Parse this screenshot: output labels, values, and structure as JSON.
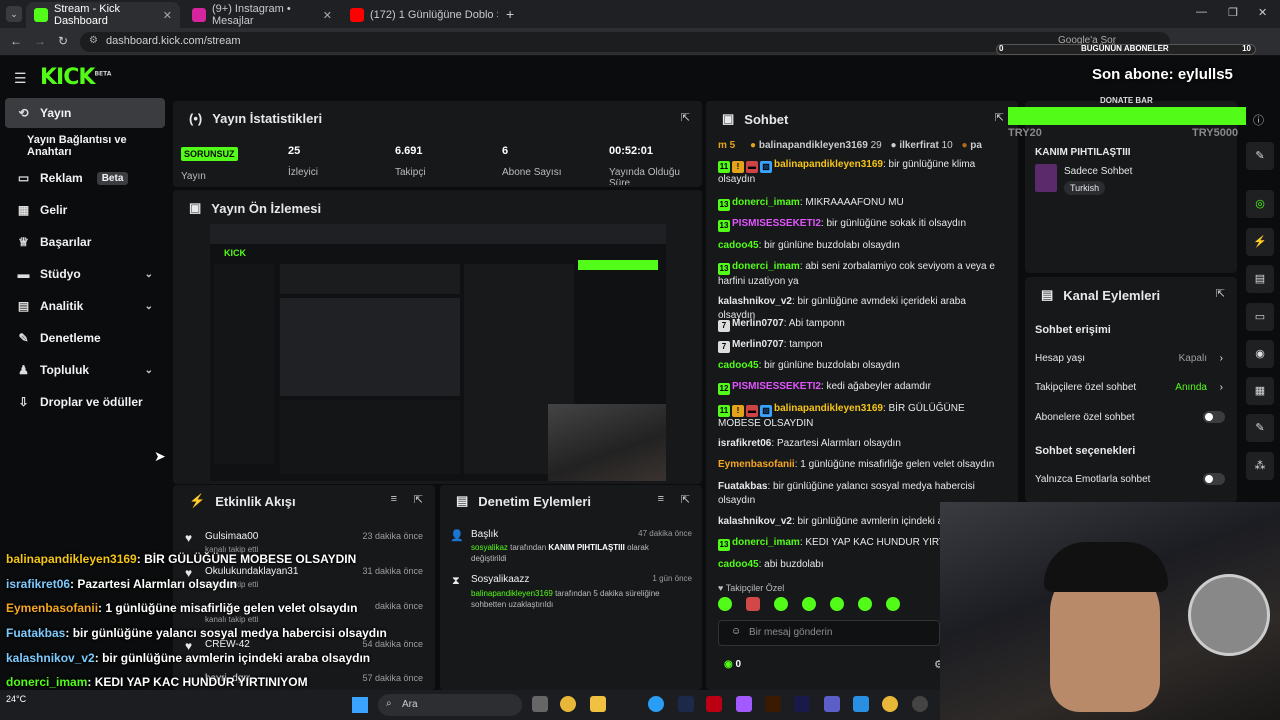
{
  "browser": {
    "tabs": [
      {
        "label": "Stream - Kick Dashboard",
        "color": "#53fc18"
      },
      {
        "label": "(9+) Instagram • Mesajlar",
        "color": "#d6249f"
      },
      {
        "label": "(172) 1 Günlüğüne Doblo Sağ",
        "color": "#ff0000"
      }
    ],
    "url": "dashboard.kick.com/stream",
    "google_search_hint": "Google'a Sor"
  },
  "overlay_top": {
    "today_subs_label": "BUGÜNÜN ABONELER",
    "today_subs_min": "0",
    "today_subs_max": "10",
    "last_sub_prefix": "Son abone:",
    "last_sub_name": "eylulls5",
    "donate_label": "DONATE BAR",
    "donate_min": "TRY20",
    "donate_max": "TRY5000"
  },
  "logo": "KICK",
  "logo_sup": "BETA",
  "sidebar": {
    "items": [
      {
        "label": "Yayın",
        "icon": "broadcast-icon"
      },
      {
        "label": "Yayın Bağlantısı ve Anahtarı",
        "icon": ""
      },
      {
        "label": "Reklam",
        "icon": "ad-icon",
        "badge": "Beta"
      },
      {
        "label": "Gelir",
        "icon": "chart-icon"
      },
      {
        "label": "Başarılar",
        "icon": "trophy-icon"
      },
      {
        "label": "Stüdyo",
        "icon": "studio-icon"
      },
      {
        "label": "Analitik",
        "icon": "analytics-icon"
      },
      {
        "label": "Denetleme",
        "icon": "wrench-icon"
      },
      {
        "label": "Topluluk",
        "icon": "community-icon"
      },
      {
        "label": "Droplar ve ödüller",
        "icon": "drops-icon"
      }
    ]
  },
  "stats": {
    "title": "Yayın İstatistikleri",
    "status": "SORUNSUZ",
    "status_label": "Yayın",
    "viewers": "25",
    "viewers_label": "İzleyici",
    "followers": "6.691",
    "followers_label": "Takipçi",
    "subs": "6",
    "subs_label": "Abone Sayısı",
    "uptime": "00:52:01",
    "uptime_label": "Yayında Olduğu Süre"
  },
  "preview": {
    "title": "Yayın Ön İzlemesi"
  },
  "activity": {
    "title": "Etkinlik Akışı",
    "items": [
      {
        "name": "Gulsimaa00",
        "sub": "kanalı takip etti",
        "time": "23 dakika önce"
      },
      {
        "name": "Okulukundaklayan31",
        "sub": "kanalı takip etti",
        "time": "31 dakika önce"
      },
      {
        "name": "",
        "sub": "kanalı takip etti",
        "time": "dakika önce"
      },
      {
        "name": "CREW-42",
        "sub": "",
        "time": "54 dakika önce"
      },
      {
        "name": "havri_dgrr",
        "sub": "",
        "time": "57 dakika önce"
      }
    ]
  },
  "moderation": {
    "title": "Denetim Eylemleri",
    "items": [
      {
        "name": "Başlık",
        "time": "47 dakika önce",
        "by": "sosyalikaz",
        "mid": " tarafından ",
        "what": "KANIM PIHTILAŞTIII",
        "end": " olarak değiştirildi"
      },
      {
        "name": "Sosyalikaazz",
        "time": "1 gün önce",
        "by": "balinapandikleyen3169",
        "mid": " tarafından 5 dakika süreliğine sohbetten uzaklaştırıldı",
        "what": "",
        "end": ""
      }
    ]
  },
  "chat": {
    "title": "Sohbet",
    "top_count": "5",
    "top_users": [
      {
        "name": "balinapandikleyen3169",
        "count": "29"
      },
      {
        "name": "ilkerfirat",
        "count": "10"
      },
      {
        "name": "pa",
        "count": ""
      }
    ],
    "messages": [
      {
        "user": "balinapandikleyen3169",
        "color": "#f5c518",
        "badges": [
          "11",
          "!",
          "▬",
          "▧"
        ],
        "text": "bir günlüğüne klima olsaydın"
      },
      {
        "user": "donerci_imam",
        "color": "#53fc18",
        "badges": [
          "13"
        ],
        "text": "MIKRAAAAFONU MU"
      },
      {
        "user": "PISMISESSEKETI2",
        "color": "#e056fd",
        "badges": [
          "13"
        ],
        "text": "bir günlüğüne sokak iti olsaydın"
      },
      {
        "user": "cadoo45",
        "color": "#53fc18",
        "badges": [],
        "text": "bir günlüne buzdolabı olsaydın"
      },
      {
        "user": "donerci_imam",
        "color": "#53fc18",
        "badges": [
          "13"
        ],
        "text": "abi seni zorbalamiyo cok seviyom a veya e harfini uzatiyon ya"
      },
      {
        "user": "kalashnikov_v2",
        "color": "#e6e8ea",
        "badges": [],
        "text": "bir günlüğüne avmdeki içerideki araba olsaydın"
      },
      {
        "user": "Merlin0707",
        "color": "#e6e8ea",
        "badges": [
          "7"
        ],
        "text": "Abi tamponn"
      },
      {
        "user": "Merlin0707",
        "color": "#e6e8ea",
        "badges": [
          "7"
        ],
        "text": "tampon"
      },
      {
        "user": "cadoo45",
        "color": "#53fc18",
        "badges": [],
        "text": "bir günlüne buzdolabı olsaydın"
      },
      {
        "user": "PISMISESSEKETI2",
        "color": "#e056fd",
        "badges": [
          "12"
        ],
        "text": "kedi ağabeyler adamdır"
      },
      {
        "user": "balinapandikleyen3169",
        "color": "#f5c518",
        "badges": [
          "11",
          "!",
          "▬",
          "▧"
        ],
        "text": "BİR GÜLÜĞÜNE MOBESE OLSAYDIN"
      },
      {
        "user": "israfikret06",
        "color": "#e6e8ea",
        "badges": [],
        "text": "Pazartesi Alarmları olsaydın"
      },
      {
        "user": "Eymenbasofanii",
        "color": "#f5a623",
        "badges": [],
        "text": "1 günlüğüne misafirliğe gelen velet olsaydın"
      },
      {
        "user": "Fuatakbas",
        "color": "#e6e8ea",
        "badges": [],
        "text": "bir günlüğüne yalancı sosyal medya habercisi olsaydın"
      },
      {
        "user": "kalashnikov_v2",
        "color": "#e6e8ea",
        "badges": [],
        "text": "bir günlüğüne avmlerin içindeki ar"
      },
      {
        "user": "donerci_imam",
        "color": "#53fc18",
        "badges": [
          "13"
        ],
        "text": "KEDI YAP KAC HUNDUR YIRTIN"
      },
      {
        "user": "cadoo45",
        "color": "#53fc18",
        "badges": [],
        "text": "abi buzdolabı"
      }
    ],
    "mode": "Takipçiler Özel",
    "input_placeholder": "Bir mesaj gönderin",
    "points": "0"
  },
  "stream_info": {
    "title": "KANIM PIHTILAŞTIII",
    "category": "Sadece Sohbet",
    "language": "Turkish"
  },
  "channel_actions": {
    "title": "Kanal Eylemleri",
    "chat_access": "Sohbet erişimi",
    "account_age_label": "Hesap yaşı",
    "account_age_value": "Kapalı",
    "followers_only_label": "Takipçilere özel sohbet",
    "followers_only_value": "Anında",
    "subs_only_label": "Abonelere özel sohbet",
    "chat_options": "Sohbet seçenekleri",
    "emotes_only_label": "Yalnızca Emotlarla sohbet"
  },
  "overlay_chat": [
    {
      "user": "balinapandikleyen3169",
      "color": "#f5c518",
      "text": ": BİR GÜLÜĞÜNE MOBESE OLSAYDIN"
    },
    {
      "user": "israfikret06",
      "color": "#7ecbff",
      "text": ": Pazartesi Alarmları olsaydın"
    },
    {
      "user": "Eymenbasofanii",
      "color": "#f5a623",
      "text": ": 1 günlüğüne misafirliğe gelen velet olsaydın"
    },
    {
      "user": "Fuatakbas",
      "color": "#7ecbff",
      "text": ": bir günlüğüne yalancı sosyal medya habercisi olsaydın"
    },
    {
      "user": "kalashnikov_v2",
      "color": "#7ecbff",
      "text": ": bir günlüğüne avmlerin içindeki araba olsaydın"
    },
    {
      "user": "donerci_imam",
      "color": "#53fc18",
      "text": ": KEDI YAP KAC HUNDUR YIRTINIYOM"
    },
    {
      "user": "cadoo45",
      "color": "#53fc18",
      "text": ": abi buzdolabı"
    }
  ],
  "taskbar": {
    "weather": "24°C",
    "search": "Ara"
  }
}
